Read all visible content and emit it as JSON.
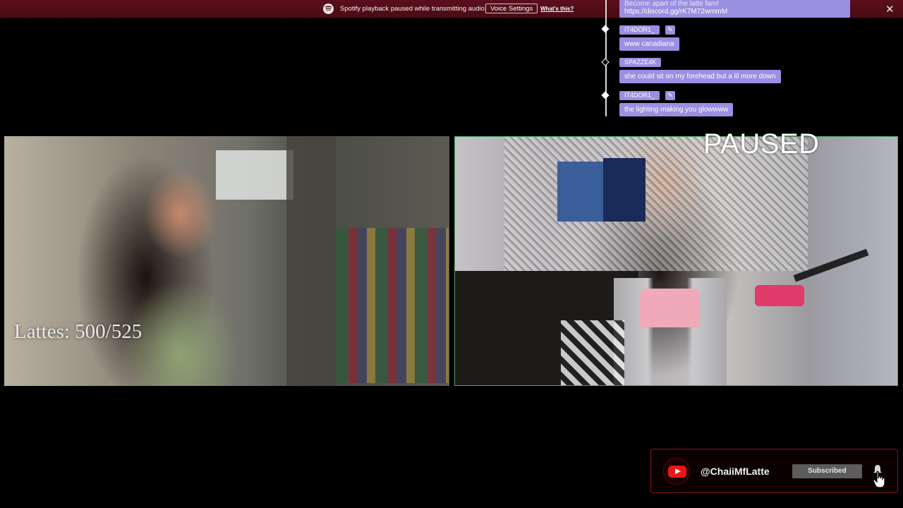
{
  "notification": {
    "text": "Spotify playback paused while transmitting audio.",
    "voice_settings_label": "Voice Settings",
    "whats_this_label": "What's this?",
    "close_label": "✕"
  },
  "chat": {
    "pinned_message": {
      "line1": "Become apart of the latte fam!",
      "line2": "https://discord.gg/rK7M72wmmM"
    },
    "messages": [
      {
        "user": "IT4DOR1_",
        "text": "www canadiana"
      },
      {
        "user": "SPAZZE4K",
        "text": "she could sit on my forehead but a lil more down"
      },
      {
        "user": "IT4DOR1_",
        "text": "the lighting making you glowwww"
      }
    ]
  },
  "overlay": {
    "lattes": "Lattes: 500/525",
    "paused": "PAUSED"
  },
  "youtube": {
    "handle": "@ChaiiMfLatte",
    "subscribed_label": "Subscribed"
  },
  "colors": {
    "chat_bubble": "#9a8fe0",
    "topbar": "#5a0f1a",
    "cam_border": "#4aa562",
    "youtube_red": "#e81818"
  }
}
